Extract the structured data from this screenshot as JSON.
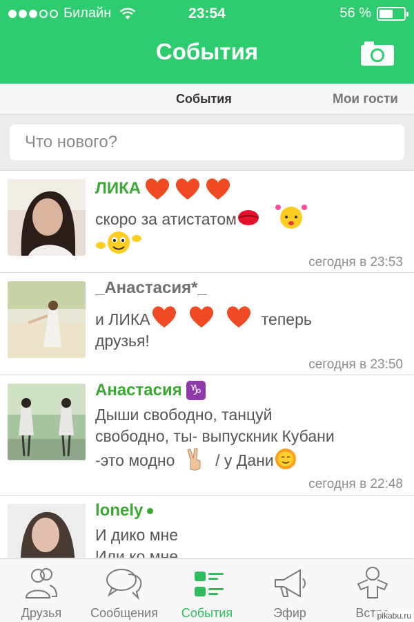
{
  "status_bar": {
    "carrier": "Билайн",
    "time": "23:54",
    "battery": "56 %",
    "battery_level": 0.56,
    "signal_bars_filled": 3,
    "signal_bars_total": 5
  },
  "header": {
    "title": "События",
    "camera_icon": "camera-icon"
  },
  "subtabs": {
    "active": "События",
    "guests": "Мои гости"
  },
  "compose": {
    "placeholder": "Что нового?"
  },
  "feed": [
    {
      "name": "ЛИКА",
      "text": "скоро за атистатом",
      "time": "сегодня в 23:53"
    },
    {
      "name": "_Анастасия*_",
      "text_a": "и ЛИКА",
      "text_b": "теперь",
      "text_c": "друзья!",
      "time": "сегодня в 23:50"
    },
    {
      "name": "Анастасия",
      "zodiac": "♑",
      "line1": "Дыши свободно, танцуй",
      "line2": "свободно, ты- выпускник Кубани",
      "line3a": "-это модно",
      "line3b": "/ у Дани",
      "time": "сегодня в 22:48"
    },
    {
      "name": "lonely",
      "line1": "И дико мне",
      "line2": "Или ко мне"
    }
  ],
  "tabbar": {
    "items": [
      {
        "label": "Друзья",
        "icon": "friends-icon"
      },
      {
        "label": "Сообщения",
        "icon": "messages-icon"
      },
      {
        "label": "События",
        "icon": "events-icon"
      },
      {
        "label": "Эфир",
        "icon": "megaphone-icon"
      },
      {
        "label": "Встре",
        "icon": "meetings-icon"
      }
    ],
    "active_index": 2
  },
  "watermark": "pikabu.ru",
  "colors": {
    "brand_green": "#2dcd6f",
    "name_green": "#3aa832",
    "zodiac_purple": "#8e3aa8"
  }
}
